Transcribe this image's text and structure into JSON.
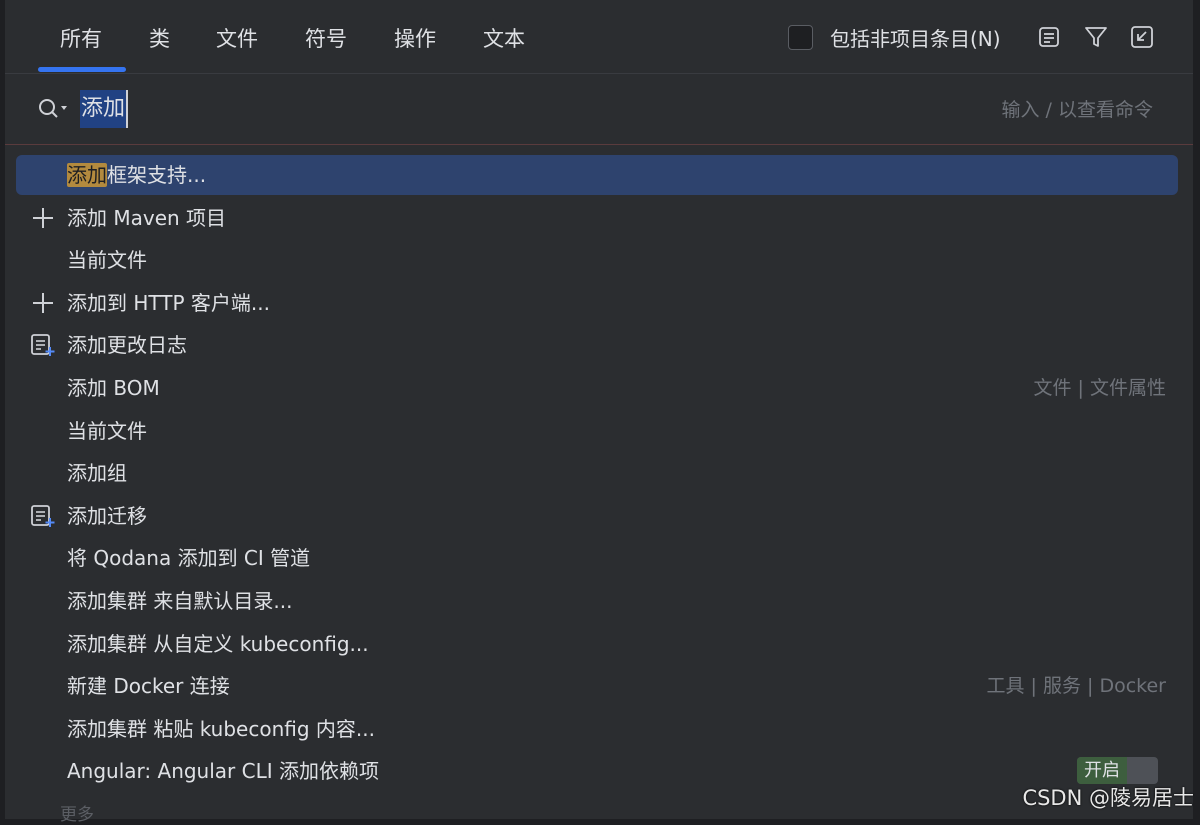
{
  "tabs": [
    "所有",
    "类",
    "文件",
    "符号",
    "操作",
    "文本"
  ],
  "header": {
    "include_label": "包括非项目条目(N)",
    "icons": [
      "list-icon",
      "filter-icon",
      "collapse-icon"
    ]
  },
  "search": {
    "value": "添加",
    "hint": "输入 / 以查看命令"
  },
  "results": [
    {
      "pre": "",
      "match": "添加",
      "post": "框架支持...",
      "location": "",
      "icon": ""
    },
    {
      "pre": "",
      "match": "",
      "post": "添加 Maven 项目",
      "location": "",
      "icon": "plus-icon"
    },
    {
      "pre": "",
      "match": "",
      "post": "当前文件",
      "location": "",
      "icon": ""
    },
    {
      "pre": "",
      "match": "",
      "post": "添加到 HTTP 客户端...",
      "location": "",
      "icon": "plus-icon"
    },
    {
      "pre": "",
      "match": "",
      "post": "添加更改日志",
      "location": "",
      "icon": "changelog-add-icon"
    },
    {
      "pre": "",
      "match": "",
      "post": "添加 BOM",
      "location": "文件 | 文件属性",
      "icon": ""
    },
    {
      "pre": "",
      "match": "",
      "post": "当前文件",
      "location": "",
      "icon": ""
    },
    {
      "pre": "",
      "match": "",
      "post": "添加组",
      "location": "",
      "icon": ""
    },
    {
      "pre": "",
      "match": "",
      "post": "添加迁移",
      "location": "",
      "icon": "changelog-add-icon"
    },
    {
      "pre": "",
      "match": "",
      "post": "将 Qodana 添加到 CI 管道",
      "location": "",
      "icon": ""
    },
    {
      "pre": "",
      "match": "",
      "post": "添加集群 来自默认目录...",
      "location": "",
      "icon": ""
    },
    {
      "pre": "",
      "match": "",
      "post": "添加集群 从自定义 kubeconfig...",
      "location": "",
      "icon": ""
    },
    {
      "pre": "",
      "match": "",
      "post": "新建 Docker 连接",
      "location": "工具 | 服务 | Docker",
      "icon": ""
    },
    {
      "pre": "",
      "match": "",
      "post": "添加集群 粘贴 kubeconfig 内容...",
      "location": "",
      "icon": ""
    },
    {
      "pre": "",
      "match": "",
      "post": "Angular: Angular CLI 添加依赖项",
      "location": "",
      "icon": "",
      "toggle": "开启"
    }
  ],
  "more_label": "更多",
  "watermark": "CSDN @陵易居士",
  "colors": {
    "background": "#2b2d30",
    "selection": "#2e436e",
    "tab_underline": "#3574f0",
    "match_highlight": "#b38a3e",
    "toggle_on": "#3d5e3e"
  }
}
